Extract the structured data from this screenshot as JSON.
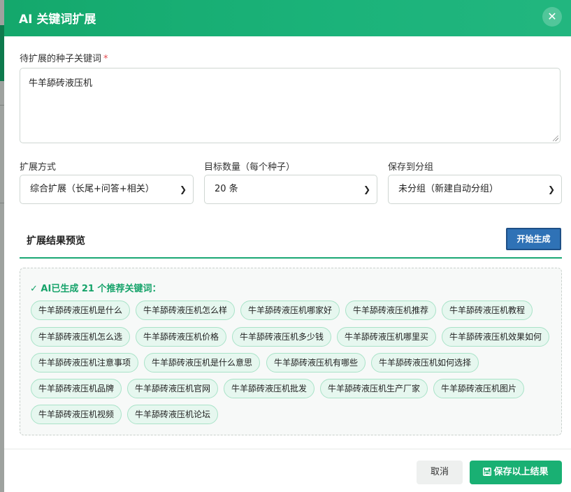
{
  "modal": {
    "title": "AI 关键词扩展",
    "close_icon": "close-icon"
  },
  "seed": {
    "label": "待扩展的种子关键词",
    "required_mark": "*",
    "value": "牛羊舔砖液压机"
  },
  "options": {
    "method_label": "扩展方式",
    "method_value": "综合扩展（长尾+问答+相关）",
    "count_label": "目标数量（每个种子）",
    "count_value": "20 条",
    "group_label": "保存到分组",
    "group_value": "未分组（新建自动分组）"
  },
  "preview": {
    "title": "扩展结果预览",
    "generate_label": "开始生成",
    "result_heading": "✓ AI已生成 21 个推荐关键词：",
    "keywords": [
      "牛羊舔砖液压机是什么",
      "牛羊舔砖液压机怎么样",
      "牛羊舔砖液压机哪家好",
      "牛羊舔砖液压机推荐",
      "牛羊舔砖液压机教程",
      "牛羊舔砖液压机怎么选",
      "牛羊舔砖液压机价格",
      "牛羊舔砖液压机多少钱",
      "牛羊舔砖液压机哪里买",
      "牛羊舔砖液压机效果如何",
      "牛羊舔砖液压机注意事项",
      "牛羊舔砖液压机是什么意思",
      "牛羊舔砖液压机有哪些",
      "牛羊舔砖液压机如何选择",
      "牛羊舔砖液压机品牌",
      "牛羊舔砖液压机官网",
      "牛羊舔砖液压机批发",
      "牛羊舔砖液压机生产厂家",
      "牛羊舔砖液压机图片",
      "牛羊舔砖液压机视频",
      "牛羊舔砖液压机论坛"
    ]
  },
  "footer": {
    "cancel_label": "取消",
    "save_label": "保存以上结果",
    "save_icon": "save-icon"
  },
  "colors": {
    "brand_green": "#19b073",
    "generate_blue": "#2f72b6",
    "chip_bg": "#e6f7ef"
  }
}
